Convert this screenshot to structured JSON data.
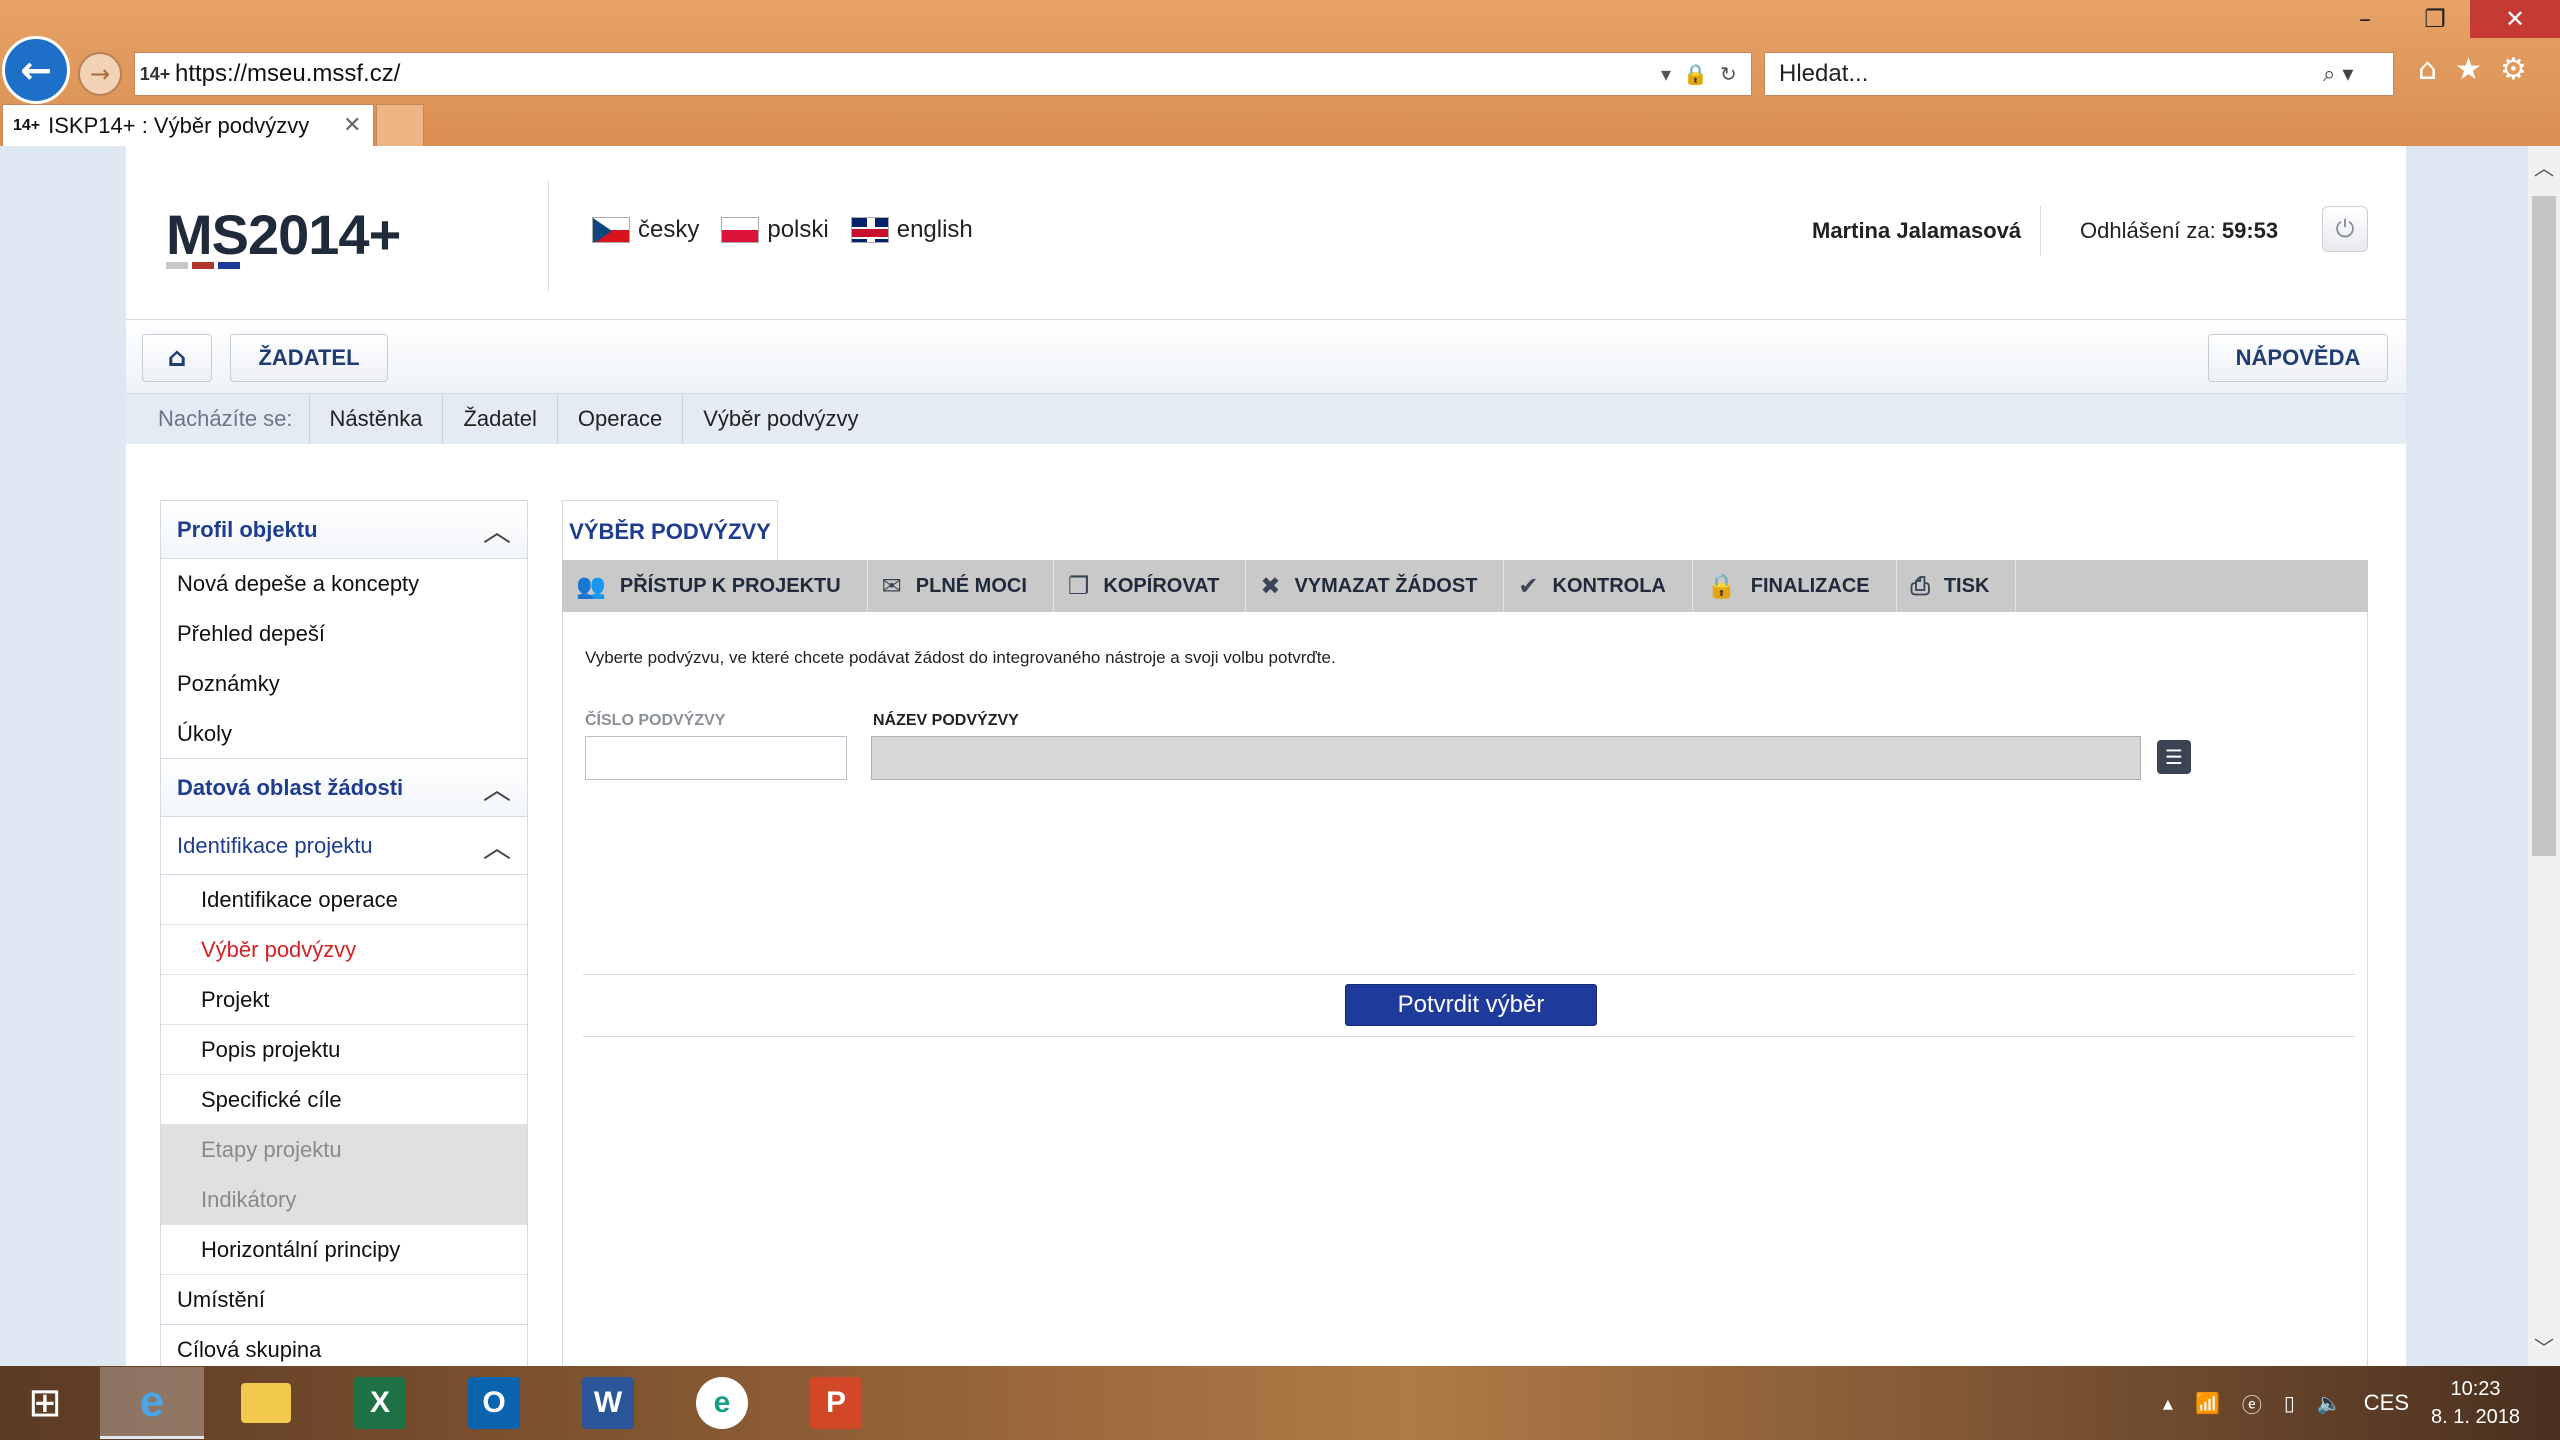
{
  "browser": {
    "url": "https://mseu.mssf.cz/",
    "search_placeholder": "Hledat...",
    "tab_title": "ISKP14+ : Výběr podvýzvy",
    "window_controls": [
      "–",
      "❐",
      "✕"
    ]
  },
  "header": {
    "logo_text": "MS2014",
    "logo_plus": "+",
    "languages": [
      {
        "label": "česky",
        "flag": "cz"
      },
      {
        "label": "polski",
        "flag": "pl"
      },
      {
        "label": "english",
        "flag": "uk"
      }
    ],
    "user_name": "Martina Jalamasová",
    "logout_label": "Odhlášení za:",
    "logout_timer": "59:53"
  },
  "navbar": {
    "zadatel_label": "ŽADATEL",
    "help_label": "NÁPOVĚDA"
  },
  "breadcrumb": {
    "label": "Nacházíte se:",
    "items": [
      "Nástěnka",
      "Žadatel",
      "Operace",
      "Výběr podvýzvy"
    ]
  },
  "sidebar": {
    "section1_title": "Profil objektu",
    "section1_items": [
      "Nová depeše a koncepty",
      "Přehled depeší",
      "Poznámky",
      "Úkoly"
    ],
    "section2_title": "Datová oblast žádosti",
    "subsection_title": "Identifikace projektu",
    "sub_items": [
      "Identifikace operace",
      "Výběr podvýzvy",
      "Projekt",
      "Popis projektu",
      "Specifické cíle",
      "Etapy projektu",
      "Indikátory",
      "Horizontální principy"
    ],
    "after_items": [
      "Umístění",
      "Cílová skupina"
    ]
  },
  "main": {
    "tab_label": "VÝBĚR PODVÝZVY",
    "toolbar": [
      "PŘÍSTUP K PROJEKTU",
      "PLNÉ MOCI",
      "KOPÍROVAT",
      "VYMAZAT ŽÁDOST",
      "KONTROLA",
      "FINALIZACE",
      "TISK"
    ],
    "instruction": "Vyberte podvýzvu, ve které chcete podávat žádost do integrovaného nástroje a svoji volbu potvrďte.",
    "label_cislo": "ČÍSLO PODVÝZVY",
    "label_nazev": "NÁZEV PODVÝZVY",
    "value_cislo": "",
    "value_nazev": "",
    "confirm_label": "Potvrdit výběr"
  },
  "taskbar": {
    "language": "CES",
    "time": "10:23",
    "date": "8. 1. 2018"
  },
  "colors": {
    "accent": "#1e3a9a",
    "active_item": "#d42126",
    "link": "#1f3d8f"
  }
}
